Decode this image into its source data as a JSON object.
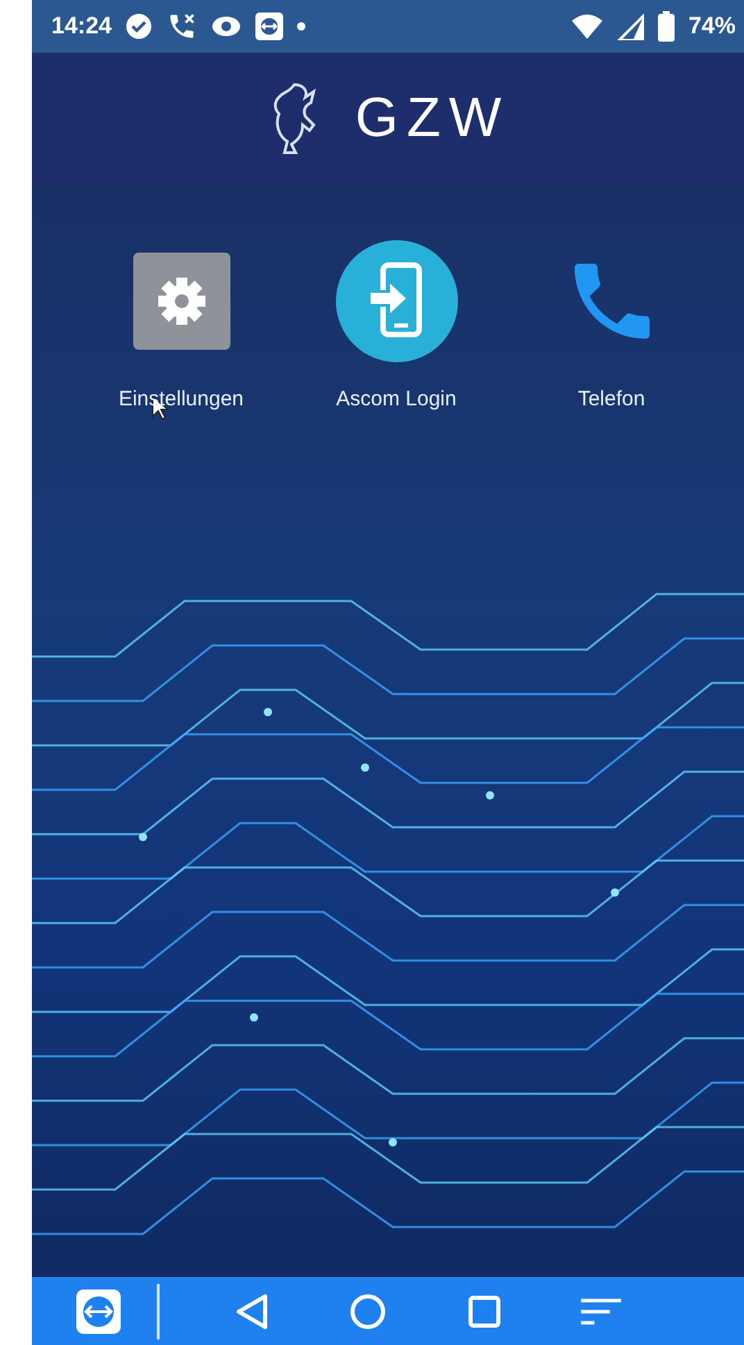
{
  "status_bar": {
    "time": "14:24",
    "battery": "74%"
  },
  "header": {
    "title": "GZW"
  },
  "apps": [
    {
      "kind": "settings",
      "label": "Einstellungen"
    },
    {
      "kind": "login",
      "label": "Ascom Login"
    },
    {
      "kind": "phone",
      "label": "Telefon"
    }
  ]
}
